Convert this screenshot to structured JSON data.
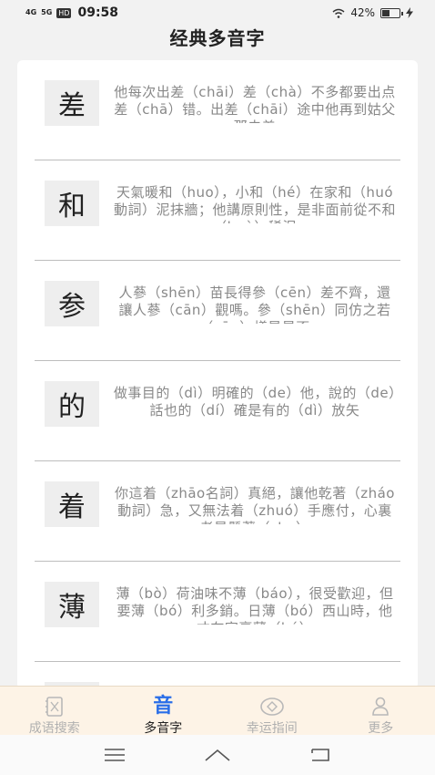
{
  "status_bar": {
    "signal1": "4G",
    "signal2": "5G",
    "hd": "HD",
    "time": "09:58",
    "battery": "42%"
  },
  "header": {
    "title": "经典多音字"
  },
  "list": [
    {
      "char": "差",
      "text": "他每次出差（chāi）差（chà）不多都要出点差（chā）错。出差（chāi）途中他再到姑父那去差"
    },
    {
      "char": "和",
      "text": "天氣暖和（huo），小和（hé）在家和（huó動詞）泥抹牆；他講原則性，是非面前從不和（huò）稀泥"
    },
    {
      "char": "参",
      "text": "人蔘（shēn）苗長得參（cēn）差不齊，還讓人蔘（cān）觀嗎。參（shēn）同仿之若（cān）樣是是否"
    },
    {
      "char": "的",
      "text": "做事目的（dì）明確的（de）他，說的（de）話也的（dí）確是有的（dì）放矢"
    },
    {
      "char": "着",
      "text": "你這着（zhāo名詞）真絕，讓他乾著（zháo動詞）急，又無法着（zhuó）手應付，心裏老是懸著（zhe）"
    },
    {
      "char": "薄",
      "text": "薄（bò）荷油味不薄（báo），很受歡迎，但要薄（bó）利多銷。日薄（bó）西山時，他才在家裏薄（bó）"
    },
    {
      "char": "",
      "text": ""
    }
  ],
  "tabs": [
    {
      "label": "成语搜索",
      "icon": "book-icon",
      "active": false
    },
    {
      "label": "多音字",
      "icon": "yin-icon",
      "active": true,
      "glyph": "音"
    },
    {
      "label": "幸运指间",
      "icon": "eye-icon",
      "active": false
    },
    {
      "label": "更多",
      "icon": "person-icon",
      "active": false
    }
  ],
  "colors": {
    "accent": "#2a6ee8",
    "tab_bar_bg": "#fdf3e6",
    "divider": "#bdbdbd",
    "char_box_bg": "#eeeeee"
  }
}
